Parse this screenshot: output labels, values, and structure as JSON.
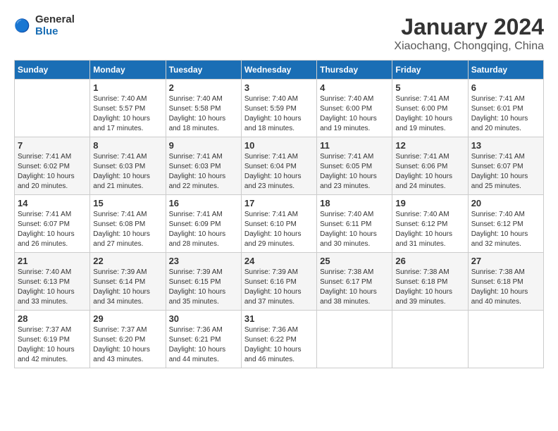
{
  "header": {
    "logo_text_general": "General",
    "logo_text_blue": "Blue",
    "month_title": "January 2024",
    "location": "Xiaochang, Chongqing, China"
  },
  "weekdays": [
    "Sunday",
    "Monday",
    "Tuesday",
    "Wednesday",
    "Thursday",
    "Friday",
    "Saturday"
  ],
  "weeks": [
    [
      {
        "day": "",
        "sunrise": "",
        "sunset": "",
        "daylight": ""
      },
      {
        "day": "1",
        "sunrise": "Sunrise: 7:40 AM",
        "sunset": "Sunset: 5:57 PM",
        "daylight": "Daylight: 10 hours and 17 minutes."
      },
      {
        "day": "2",
        "sunrise": "Sunrise: 7:40 AM",
        "sunset": "Sunset: 5:58 PM",
        "daylight": "Daylight: 10 hours and 18 minutes."
      },
      {
        "day": "3",
        "sunrise": "Sunrise: 7:40 AM",
        "sunset": "Sunset: 5:59 PM",
        "daylight": "Daylight: 10 hours and 18 minutes."
      },
      {
        "day": "4",
        "sunrise": "Sunrise: 7:40 AM",
        "sunset": "Sunset: 6:00 PM",
        "daylight": "Daylight: 10 hours and 19 minutes."
      },
      {
        "day": "5",
        "sunrise": "Sunrise: 7:41 AM",
        "sunset": "Sunset: 6:00 PM",
        "daylight": "Daylight: 10 hours and 19 minutes."
      },
      {
        "day": "6",
        "sunrise": "Sunrise: 7:41 AM",
        "sunset": "Sunset: 6:01 PM",
        "daylight": "Daylight: 10 hours and 20 minutes."
      }
    ],
    [
      {
        "day": "7",
        "sunrise": "Sunrise: 7:41 AM",
        "sunset": "Sunset: 6:02 PM",
        "daylight": "Daylight: 10 hours and 20 minutes."
      },
      {
        "day": "8",
        "sunrise": "Sunrise: 7:41 AM",
        "sunset": "Sunset: 6:03 PM",
        "daylight": "Daylight: 10 hours and 21 minutes."
      },
      {
        "day": "9",
        "sunrise": "Sunrise: 7:41 AM",
        "sunset": "Sunset: 6:03 PM",
        "daylight": "Daylight: 10 hours and 22 minutes."
      },
      {
        "day": "10",
        "sunrise": "Sunrise: 7:41 AM",
        "sunset": "Sunset: 6:04 PM",
        "daylight": "Daylight: 10 hours and 23 minutes."
      },
      {
        "day": "11",
        "sunrise": "Sunrise: 7:41 AM",
        "sunset": "Sunset: 6:05 PM",
        "daylight": "Daylight: 10 hours and 23 minutes."
      },
      {
        "day": "12",
        "sunrise": "Sunrise: 7:41 AM",
        "sunset": "Sunset: 6:06 PM",
        "daylight": "Daylight: 10 hours and 24 minutes."
      },
      {
        "day": "13",
        "sunrise": "Sunrise: 7:41 AM",
        "sunset": "Sunset: 6:07 PM",
        "daylight": "Daylight: 10 hours and 25 minutes."
      }
    ],
    [
      {
        "day": "14",
        "sunrise": "Sunrise: 7:41 AM",
        "sunset": "Sunset: 6:07 PM",
        "daylight": "Daylight: 10 hours and 26 minutes."
      },
      {
        "day": "15",
        "sunrise": "Sunrise: 7:41 AM",
        "sunset": "Sunset: 6:08 PM",
        "daylight": "Daylight: 10 hours and 27 minutes."
      },
      {
        "day": "16",
        "sunrise": "Sunrise: 7:41 AM",
        "sunset": "Sunset: 6:09 PM",
        "daylight": "Daylight: 10 hours and 28 minutes."
      },
      {
        "day": "17",
        "sunrise": "Sunrise: 7:41 AM",
        "sunset": "Sunset: 6:10 PM",
        "daylight": "Daylight: 10 hours and 29 minutes."
      },
      {
        "day": "18",
        "sunrise": "Sunrise: 7:40 AM",
        "sunset": "Sunset: 6:11 PM",
        "daylight": "Daylight: 10 hours and 30 minutes."
      },
      {
        "day": "19",
        "sunrise": "Sunrise: 7:40 AM",
        "sunset": "Sunset: 6:12 PM",
        "daylight": "Daylight: 10 hours and 31 minutes."
      },
      {
        "day": "20",
        "sunrise": "Sunrise: 7:40 AM",
        "sunset": "Sunset: 6:12 PM",
        "daylight": "Daylight: 10 hours and 32 minutes."
      }
    ],
    [
      {
        "day": "21",
        "sunrise": "Sunrise: 7:40 AM",
        "sunset": "Sunset: 6:13 PM",
        "daylight": "Daylight: 10 hours and 33 minutes."
      },
      {
        "day": "22",
        "sunrise": "Sunrise: 7:39 AM",
        "sunset": "Sunset: 6:14 PM",
        "daylight": "Daylight: 10 hours and 34 minutes."
      },
      {
        "day": "23",
        "sunrise": "Sunrise: 7:39 AM",
        "sunset": "Sunset: 6:15 PM",
        "daylight": "Daylight: 10 hours and 35 minutes."
      },
      {
        "day": "24",
        "sunrise": "Sunrise: 7:39 AM",
        "sunset": "Sunset: 6:16 PM",
        "daylight": "Daylight: 10 hours and 37 minutes."
      },
      {
        "day": "25",
        "sunrise": "Sunrise: 7:38 AM",
        "sunset": "Sunset: 6:17 PM",
        "daylight": "Daylight: 10 hours and 38 minutes."
      },
      {
        "day": "26",
        "sunrise": "Sunrise: 7:38 AM",
        "sunset": "Sunset: 6:18 PM",
        "daylight": "Daylight: 10 hours and 39 minutes."
      },
      {
        "day": "27",
        "sunrise": "Sunrise: 7:38 AM",
        "sunset": "Sunset: 6:18 PM",
        "daylight": "Daylight: 10 hours and 40 minutes."
      }
    ],
    [
      {
        "day": "28",
        "sunrise": "Sunrise: 7:37 AM",
        "sunset": "Sunset: 6:19 PM",
        "daylight": "Daylight: 10 hours and 42 minutes."
      },
      {
        "day": "29",
        "sunrise": "Sunrise: 7:37 AM",
        "sunset": "Sunset: 6:20 PM",
        "daylight": "Daylight: 10 hours and 43 minutes."
      },
      {
        "day": "30",
        "sunrise": "Sunrise: 7:36 AM",
        "sunset": "Sunset: 6:21 PM",
        "daylight": "Daylight: 10 hours and 44 minutes."
      },
      {
        "day": "31",
        "sunrise": "Sunrise: 7:36 AM",
        "sunset": "Sunset: 6:22 PM",
        "daylight": "Daylight: 10 hours and 46 minutes."
      },
      {
        "day": "",
        "sunrise": "",
        "sunset": "",
        "daylight": ""
      },
      {
        "day": "",
        "sunrise": "",
        "sunset": "",
        "daylight": ""
      },
      {
        "day": "",
        "sunrise": "",
        "sunset": "",
        "daylight": ""
      }
    ]
  ]
}
